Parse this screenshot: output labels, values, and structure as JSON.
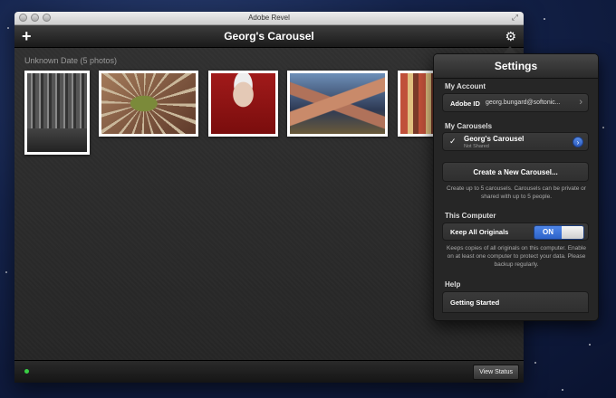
{
  "window": {
    "title": "Adobe Revel"
  },
  "toolbar": {
    "title": "Georg's Carousel",
    "add_icon": "plus-icon",
    "settings_icon": "gear-icon"
  },
  "library": {
    "date_label": "Unknown Date (5 photos)",
    "photos": [
      {
        "name": "city-skyline-bw"
      },
      {
        "name": "cactus-closeup"
      },
      {
        "name": "elderly-woman-portrait"
      },
      {
        "name": "hammock-legs"
      },
      {
        "name": "colorful-buildings"
      }
    ]
  },
  "status": {
    "view_status_label": "View Status",
    "status_color": "#39d045"
  },
  "settings": {
    "title": "Settings",
    "my_account": {
      "section": "My Account",
      "label": "Adobe ID",
      "value": "georg.bungard@softonic..."
    },
    "my_carousels": {
      "section": "My Carousels",
      "name": "Georg's Carousel",
      "sub": "Not Shared"
    },
    "create_button": "Create a New Carousel...",
    "create_note": "Create up to 5 carousels. Carousels can be private or shared with up to 5 people.",
    "this_computer": {
      "section": "This Computer",
      "label": "Keep All Originals",
      "toggle": "ON"
    },
    "computer_note": "Keeps copies of all originals on this computer. Enable on at least one computer to protect your data. Please backup regularly.",
    "help": {
      "section": "Help",
      "getting_started": "Getting Started"
    }
  }
}
